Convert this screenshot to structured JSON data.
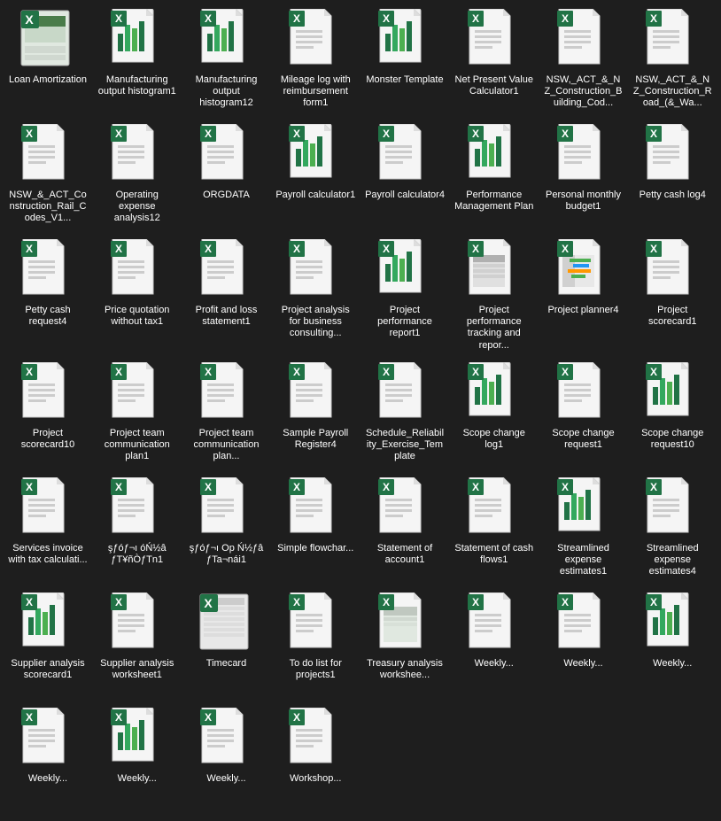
{
  "colors": {
    "bg": "#1e1e1e",
    "text": "#ffffff",
    "excel_green": "#217346",
    "excel_light": "#33a85e",
    "doc_blue": "#2b579a",
    "doc_light": "#4472c4",
    "page_bg": "#e8e8e8",
    "page_fold": "#c0c0c0",
    "green_icon": "#4caf50",
    "bar_green": "#4caf50",
    "bar_teal": "#009688"
  },
  "files": [
    {
      "name": "Loan Amortization",
      "type": "screenshot"
    },
    {
      "name": "Manufacturing output histogram1",
      "type": "excel_chart"
    },
    {
      "name": "Manufacturing output histogram12",
      "type": "excel_chart"
    },
    {
      "name": "Mileage log with reimbursement form1",
      "type": "excel_doc"
    },
    {
      "name": "Monster Template",
      "type": "excel_chart"
    },
    {
      "name": "Net Present Value Calculator1",
      "type": "excel_doc"
    },
    {
      "name": "NSW,_ACT_&_NZ_Construction_Building_Cod...",
      "type": "excel_doc"
    },
    {
      "name": "NSW,_ACT_&_NZ_Construction_Road_(&_Wa...",
      "type": "excel_doc"
    },
    {
      "name": "NSW_&_ACT_Construction_Rail_Codes_V1...",
      "type": "excel_doc"
    },
    {
      "name": "Operating expense analysis12",
      "type": "excel_doc"
    },
    {
      "name": "ORGDATA",
      "type": "excel_doc"
    },
    {
      "name": "Payroll calculator1",
      "type": "excel_chart"
    },
    {
      "name": "Payroll calculator4",
      "type": "excel_doc"
    },
    {
      "name": "Performance Management Plan",
      "type": "excel_chart"
    },
    {
      "name": "Personal monthly budget1",
      "type": "excel_doc"
    },
    {
      "name": "Petty cash log4",
      "type": "excel_doc"
    },
    {
      "name": "Petty cash request4",
      "type": "excel_doc"
    },
    {
      "name": "Price quotation without tax1",
      "type": "excel_doc"
    },
    {
      "name": "Profit and loss statement1",
      "type": "excel_doc"
    },
    {
      "name": "Project analysis for business consulting...",
      "type": "excel_doc"
    },
    {
      "name": "Project performance report1",
      "type": "excel_chart"
    },
    {
      "name": "Project performance tracking and repor...",
      "type": "excel_screenshot"
    },
    {
      "name": "Project planner4",
      "type": "excel_screenshot2"
    },
    {
      "name": "Project scorecard1",
      "type": "excel_doc"
    },
    {
      "name": "Project scorecard10",
      "type": "excel_doc"
    },
    {
      "name": "Project team communication plan1",
      "type": "excel_doc"
    },
    {
      "name": "Project team communication plan...",
      "type": "excel_doc"
    },
    {
      "name": "Sample Payroll Register4",
      "type": "excel_doc"
    },
    {
      "name": "Schedule_Reliability_Exercise_Template",
      "type": "excel_doc"
    },
    {
      "name": "Scope change log1",
      "type": "excel_chart"
    },
    {
      "name": "Scope change request1",
      "type": "excel_doc"
    },
    {
      "name": "Scope change request10",
      "type": "excel_chart"
    },
    {
      "name": "Services invoice with tax calculati...",
      "type": "excel_doc"
    },
    {
      "name": "şƒóƒ¬ı óŃ½â ƒT¥ñÒƒTn1",
      "type": "excel_doc"
    },
    {
      "name": "şƒóƒ¬ı Op Ń½ƒâ ƒTa¬nái1",
      "type": "excel_doc"
    },
    {
      "name": "Simple flowchar...",
      "type": "excel_doc"
    },
    {
      "name": "Statement of account1",
      "type": "excel_doc"
    },
    {
      "name": "Statement of cash flows1",
      "type": "excel_doc"
    },
    {
      "name": "Streamlined expense estimates1",
      "type": "excel_chart"
    },
    {
      "name": "Streamlined expense estimates4",
      "type": "excel_doc"
    },
    {
      "name": "Supplier analysis scorecard1",
      "type": "excel_chart"
    },
    {
      "name": "Supplier analysis worksheet1",
      "type": "excel_doc"
    },
    {
      "name": "Timecard",
      "type": "screenshot2"
    },
    {
      "name": "To do list for projects1",
      "type": "excel_doc"
    },
    {
      "name": "Treasury analysis workshee...",
      "type": "excel_screenshot3"
    },
    {
      "name": "Weekly...",
      "type": "excel_doc"
    },
    {
      "name": "Weekly...",
      "type": "excel_doc"
    },
    {
      "name": "Weekly...",
      "type": "excel_chart"
    },
    {
      "name": "Weekly...",
      "type": "excel_doc"
    },
    {
      "name": "Weekly...",
      "type": "excel_chart"
    },
    {
      "name": "Weekly...",
      "type": "excel_doc"
    },
    {
      "name": "Workshop...",
      "type": "excel_doc"
    }
  ]
}
